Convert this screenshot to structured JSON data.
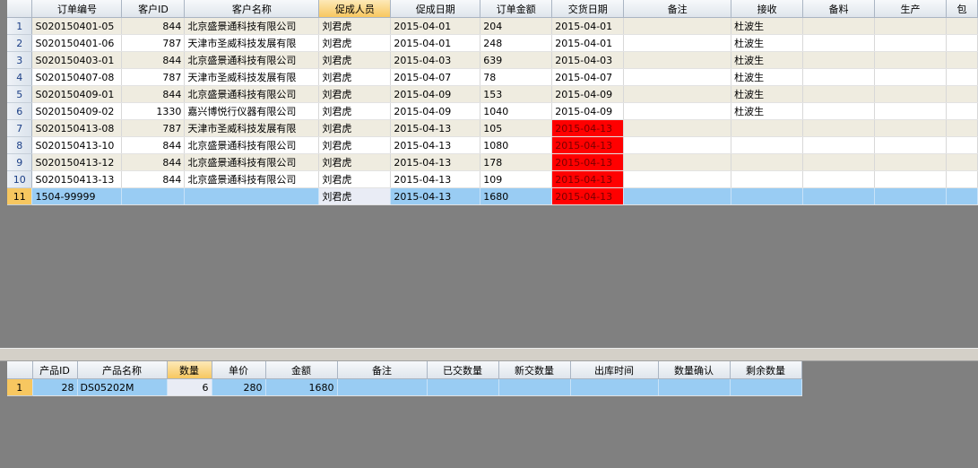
{
  "orders": {
    "columns": [
      "订单编号",
      "客户ID",
      "客户名称",
      "促成人员",
      "促成日期",
      "订单金额",
      "交货日期",
      "备注",
      "接收",
      "备料",
      "生产",
      "包"
    ],
    "rows": [
      {
        "n": "1",
        "id": "S020150401-05",
        "cust": "844",
        "name": "北京盛景通科技有限公司",
        "staff": "刘君虎",
        "date": "2015-04-01",
        "amt": "204",
        "deliv": "2015-04-01",
        "note": "",
        "recv": "杜波生",
        "prep": "",
        "prod": "",
        "pack": ""
      },
      {
        "n": "2",
        "id": "S020150401-06",
        "cust": "787",
        "name": "天津市圣威科技发展有限",
        "staff": "刘君虎",
        "date": "2015-04-01",
        "amt": "248",
        "deliv": "2015-04-01",
        "note": "",
        "recv": "杜波生",
        "prep": "",
        "prod": "",
        "pack": ""
      },
      {
        "n": "3",
        "id": "S020150403-01",
        "cust": "844",
        "name": "北京盛景通科技有限公司",
        "staff": "刘君虎",
        "date": "2015-04-03",
        "amt": "639",
        "deliv": "2015-04-03",
        "note": "",
        "recv": "杜波生",
        "prep": "",
        "prod": "",
        "pack": ""
      },
      {
        "n": "4",
        "id": "S020150407-08",
        "cust": "787",
        "name": "天津市圣威科技发展有限",
        "staff": "刘君虎",
        "date": "2015-04-07",
        "amt": "78",
        "deliv": "2015-04-07",
        "note": "",
        "recv": "杜波生",
        "prep": "",
        "prod": "",
        "pack": ""
      },
      {
        "n": "5",
        "id": "S020150409-01",
        "cust": "844",
        "name": "北京盛景通科技有限公司",
        "staff": "刘君虎",
        "date": "2015-04-09",
        "amt": "153",
        "deliv": "2015-04-09",
        "note": "",
        "recv": "杜波生",
        "prep": "",
        "prod": "",
        "pack": ""
      },
      {
        "n": "6",
        "id": "S020150409-02",
        "cust": "1330",
        "name": "嘉兴博悦行仪器有限公司",
        "staff": "刘君虎",
        "date": "2015-04-09",
        "amt": "1040",
        "deliv": "2015-04-09",
        "note": "",
        "recv": "杜波生",
        "prep": "",
        "prod": "",
        "pack": ""
      },
      {
        "n": "7",
        "id": "S020150413-08",
        "cust": "787",
        "name": "天津市圣威科技发展有限",
        "staff": "刘君虎",
        "date": "2015-04-13",
        "amt": "105",
        "deliv": "2015-04-13",
        "note": "",
        "recv": "",
        "prep": "",
        "prod": "",
        "pack": "",
        "late": true
      },
      {
        "n": "8",
        "id": "S020150413-10",
        "cust": "844",
        "name": "北京盛景通科技有限公司",
        "staff": "刘君虎",
        "date": "2015-04-13",
        "amt": "1080",
        "deliv": "2015-04-13",
        "note": "",
        "recv": "",
        "prep": "",
        "prod": "",
        "pack": "",
        "late": true
      },
      {
        "n": "9",
        "id": "S020150413-12",
        "cust": "844",
        "name": "北京盛景通科技有限公司",
        "staff": "刘君虎",
        "date": "2015-04-13",
        "amt": "178",
        "deliv": "2015-04-13",
        "note": "",
        "recv": "",
        "prep": "",
        "prod": "",
        "pack": "",
        "late": true
      },
      {
        "n": "10",
        "id": "S020150413-13",
        "cust": "844",
        "name": "北京盛景通科技有限公司",
        "staff": "刘君虎",
        "date": "2015-04-13",
        "amt": "109",
        "deliv": "2015-04-13",
        "note": "",
        "recv": "",
        "prep": "",
        "prod": "",
        "pack": "",
        "late": true
      },
      {
        "n": "11",
        "id": "1504-99999",
        "cust": "",
        "name": "",
        "staff": "刘君虎",
        "date": "2015-04-13",
        "amt": "1680",
        "deliv": "2015-04-13",
        "note": "",
        "recv": "",
        "prep": "",
        "prod": "",
        "pack": "",
        "late": true,
        "selected": true
      }
    ]
  },
  "items": {
    "columns": [
      "产品ID",
      "产品名称",
      "数量",
      "单价",
      "金额",
      "备注",
      "已交数量",
      "新交数量",
      "出库时间",
      "数量确认",
      "剩余数量"
    ],
    "rows": [
      {
        "n": "1",
        "pid": "28",
        "pname": "DS05202M",
        "qty": "6",
        "price": "280",
        "amt": "1680",
        "note": "",
        "done": "",
        "newq": "",
        "out": "",
        "conf": "",
        "left": "",
        "selected": true
      }
    ]
  },
  "colors": {
    "late": "#ff0000",
    "selected_row": "#99ccf3",
    "sorted_header": "#f7c760"
  }
}
